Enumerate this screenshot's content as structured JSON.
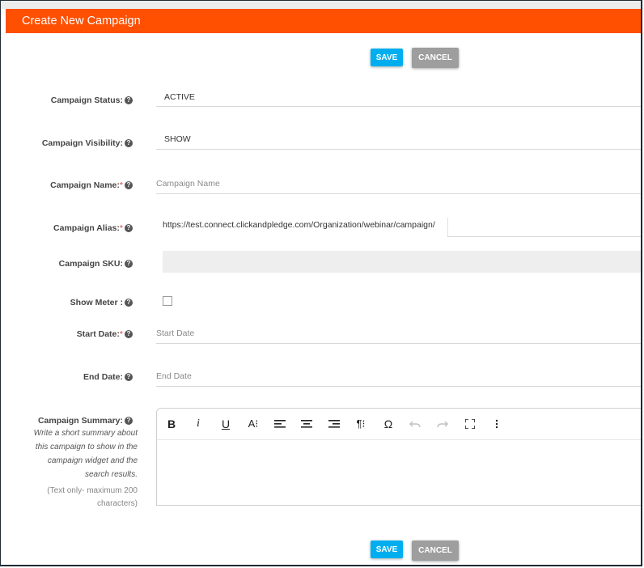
{
  "header": {
    "title": "Create New Campaign"
  },
  "buttons": {
    "save": "SAVE",
    "cancel": "CANCEL"
  },
  "form": {
    "status": {
      "label": "Campaign Status:",
      "value": "ACTIVE"
    },
    "visibility": {
      "label": "Campaign Visibility:",
      "value": "SHOW"
    },
    "name": {
      "label": "Campaign Name:",
      "required": "*",
      "placeholder": "Campaign Name"
    },
    "alias": {
      "label": "Campaign Alias:",
      "required": "*",
      "value": "https://test.connect.clickandpledge.com/Organization/webinar/campaign/"
    },
    "sku": {
      "label": "Campaign SKU:"
    },
    "meter": {
      "label": "Show Meter :",
      "checked": false
    },
    "start_date": {
      "label": "Start Date:",
      "required": "*",
      "placeholder": "Start Date"
    },
    "end_date": {
      "label": "End Date:",
      "placeholder": "End Date"
    },
    "summary": {
      "label": "Campaign Summary:",
      "help_lines": [
        "Write a short summary about",
        "this campaign to show in the",
        "campaign widget and the",
        "search results."
      ],
      "note_lines": [
        "(Text only- maximum 200",
        "characters)"
      ]
    }
  },
  "editor_toolbar": {
    "bold": "B",
    "italic": "i",
    "underline": "U",
    "font_size": "A⁝",
    "paragraph": "¶⁝",
    "special_char": "Ω",
    "icons": [
      "bold-icon",
      "italic-icon",
      "underline-icon",
      "font-size-icon",
      "align-left-icon",
      "align-center-icon",
      "align-right-icon",
      "paragraph-format-icon",
      "special-character-icon",
      "undo-icon",
      "redo-icon",
      "fullscreen-icon",
      "more-icon"
    ]
  },
  "help_icon": "?"
}
